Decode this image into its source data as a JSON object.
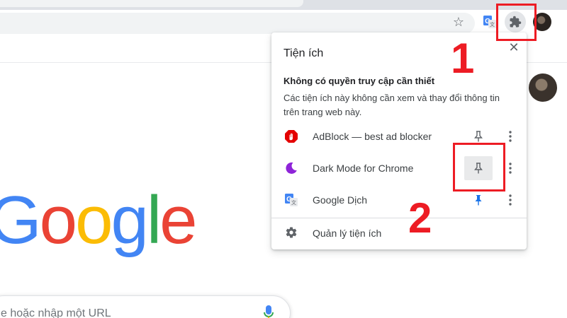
{
  "annotations": {
    "step1_label": "1",
    "step2_label": "2",
    "color": "#ed1c24"
  },
  "toolbar": {
    "icons": [
      "star-icon",
      "google-translate-extension-icon",
      "puzzle-piece-icon",
      "profile-avatar"
    ]
  },
  "popup": {
    "title": "Tiện ích",
    "close_icon": "close-icon",
    "section_heading": "Không có quyền truy cập cần thiết",
    "section_description": "Các tiện ích này không cần xem và thay đổi thông tin trên trang web này.",
    "extensions": [
      {
        "name": "AdBlock — best ad blocker",
        "icon": "adblock-icon",
        "pinned": false
      },
      {
        "name": "Dark Mode for Chrome",
        "icon": "dark-mode-moon-icon",
        "pinned": false
      },
      {
        "name": "Google Dịch",
        "icon": "google-translate-icon",
        "pinned": true
      }
    ],
    "manage_label": "Quản lý tiện ích",
    "pin_color_active": "#1a73e8",
    "pin_color_inactive": "#5f6368"
  },
  "page": {
    "logo_letters": [
      "G",
      "o",
      "o",
      "g",
      "l",
      "e"
    ],
    "logo_colors": [
      "#4285f4",
      "#ea4335",
      "#fbbc05",
      "#4285f4",
      "#34a853",
      "#ea4335"
    ],
    "search_placeholder": "e hoặc nhập một URL"
  }
}
